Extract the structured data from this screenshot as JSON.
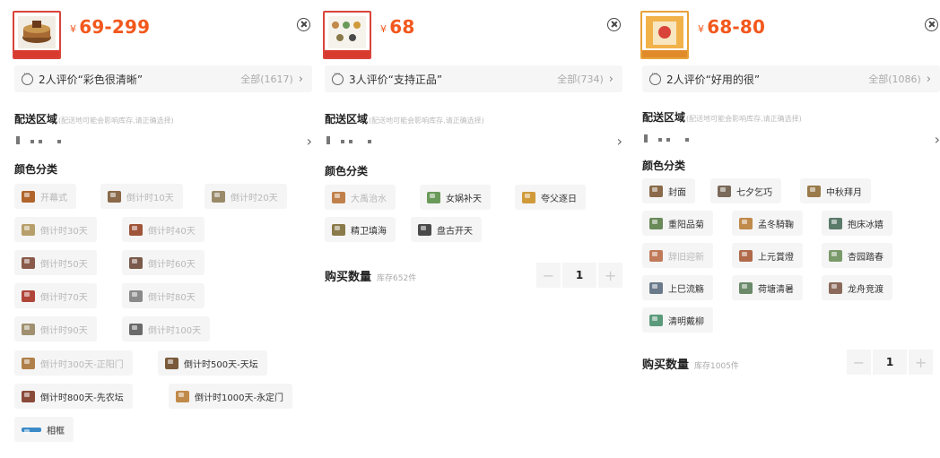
{
  "panels": [
    {
      "price": "69-299",
      "currency": "¥",
      "review": {
        "text": "2人评价“彩色很清晰”",
        "all": "全部(1617)"
      },
      "region": {
        "title": "配送区域",
        "hint": "(配送地可能会影响库存,请正确选择)"
      },
      "color_section": "颜色分类",
      "options": [
        {
          "label": "开幕式",
          "enabled": false,
          "icon_color": "#b0652b"
        },
        {
          "label": "倒计时10天",
          "enabled": false,
          "icon_color": "#8a6a4a"
        },
        {
          "label": "倒计时20天",
          "enabled": false,
          "icon_color": "#9a8a6a"
        },
        {
          "label": "倒计时30天",
          "enabled": false,
          "icon_color": "#b79f6b"
        },
        {
          "label": "倒计时40天",
          "enabled": false,
          "icon_color": "#a0553a"
        },
        {
          "label": "倒计时50天",
          "enabled": false,
          "icon_color": "#8a5a4a"
        },
        {
          "label": "倒计时60天",
          "enabled": false,
          "icon_color": "#7a5a4a"
        },
        {
          "label": "倒计时70天",
          "enabled": false,
          "icon_color": "#b0453a"
        },
        {
          "label": "倒计时80天",
          "enabled": false,
          "icon_color": "#8a8a8a"
        },
        {
          "label": "倒计时90天",
          "enabled": false,
          "icon_color": "#a09070"
        },
        {
          "label": "倒计时100天",
          "enabled": false,
          "icon_color": "#6a6a6a"
        },
        {
          "label": "倒计时300天-正阳门",
          "enabled": false,
          "icon_color": "#b0804a"
        },
        {
          "label": "倒计时500天-天坛",
          "enabled": true,
          "icon_color": "#7a5a3a"
        },
        {
          "label": "倒计时800天-先农坛",
          "enabled": true,
          "icon_color": "#8a4a3a"
        },
        {
          "label": "倒计时1000天-永定门",
          "enabled": true,
          "icon_color": "#c08a4a"
        },
        {
          "label": "相框",
          "enabled": true,
          "icon_color": "#3a8ac8"
        }
      ]
    },
    {
      "price": "68",
      "currency": "¥",
      "review": {
        "text": "3人评价“支持正品”",
        "all": "全部(734)"
      },
      "region": {
        "title": "配送区域",
        "hint": "(配送地可能会影响库存,请正确选择)"
      },
      "color_section": "颜色分类",
      "options": [
        {
          "label": "大禹治水",
          "enabled": false,
          "icon_color": "#c0804a"
        },
        {
          "label": "女娲补天",
          "enabled": true,
          "icon_color": "#6a9a5a"
        },
        {
          "label": "夸父逐日",
          "enabled": true,
          "icon_color": "#d09a3a"
        },
        {
          "label": "精卫填海",
          "enabled": true,
          "icon_color": "#8a7a4a"
        },
        {
          "label": "盘古开天",
          "enabled": true,
          "icon_color": "#4a4a4a"
        }
      ],
      "quantity": {
        "label": "购买数量",
        "stock": "库存652件",
        "value": "1",
        "minus": "−",
        "plus": "+"
      }
    },
    {
      "price": "68-80",
      "currency": "¥",
      "review": {
        "text": "2人评价“好用的很”",
        "all": "全部(1086)"
      },
      "region": {
        "title": "配送区域",
        "hint": "(配送地可能会影响库存,请正确选择)"
      },
      "color_section": "颜色分类",
      "options": [
        {
          "label": "封面",
          "enabled": true,
          "icon_color": "#8a6a4a"
        },
        {
          "label": "七夕乞巧",
          "enabled": true,
          "icon_color": "#7a6a5a"
        },
        {
          "label": "中秋拜月",
          "enabled": true,
          "icon_color": "#9a7a4a"
        },
        {
          "label": "重阳品菊",
          "enabled": true,
          "icon_color": "#6a8a5a"
        },
        {
          "label": "孟冬騎鞠",
          "enabled": true,
          "icon_color": "#c08a4a"
        },
        {
          "label": "抱床冰嬉",
          "enabled": true,
          "icon_color": "#5a7a6a"
        },
        {
          "label": "辞旧迎新",
          "enabled": false,
          "icon_color": "#c07a5a"
        },
        {
          "label": "上元賞燈",
          "enabled": true,
          "icon_color": "#b06a4a"
        },
        {
          "label": "杏园踏春",
          "enabled": true,
          "icon_color": "#7a9a6a"
        },
        {
          "label": "上巳流觞",
          "enabled": true,
          "icon_color": "#6a7a8a"
        },
        {
          "label": "荷塘清暑",
          "enabled": true,
          "icon_color": "#6a8a6a"
        },
        {
          "label": "龙舟竞渡",
          "enabled": true,
          "icon_color": "#8a6a5a"
        },
        {
          "label": "清明戴柳",
          "enabled": true,
          "icon_color": "#5a9a7a"
        }
      ],
      "quantity": {
        "label": "购买数量",
        "stock": "库存1005件",
        "value": "1",
        "minus": "−",
        "plus": "+"
      }
    }
  ]
}
